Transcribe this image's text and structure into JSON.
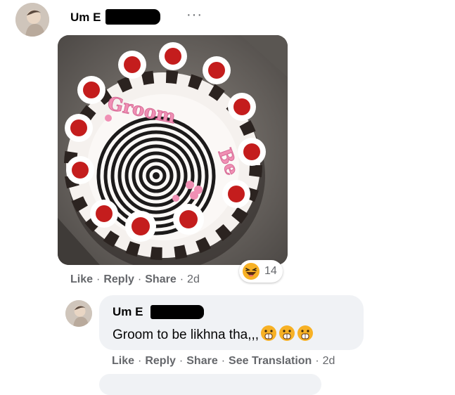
{
  "post": {
    "author_name": "Um E",
    "more_icon": "more-icon",
    "photo": {
      "cake_text_line1": "Groom",
      "cake_text_line2": "Be"
    },
    "actions": {
      "like": "Like",
      "reply": "Reply",
      "share": "Share",
      "time": "2d"
    },
    "reaction": {
      "icon": "laughing-emoji-icon",
      "count": "14"
    }
  },
  "reply": {
    "author_name": "Um E",
    "text": "Groom to be likhna tha,,,",
    "emoji_icons": [
      "face-with-open-mouth-emoji-icon",
      "face-with-open-mouth-emoji-icon",
      "face-with-open-mouth-emoji-icon"
    ],
    "actions": {
      "like": "Like",
      "reply": "Reply",
      "share": "Share",
      "see_translation": "See Translation",
      "time": "2d"
    }
  },
  "colors": {
    "secondary_text": "#65676b",
    "bubble_bg": "#f0f2f5",
    "reaction_yellow": "#f7b125"
  }
}
